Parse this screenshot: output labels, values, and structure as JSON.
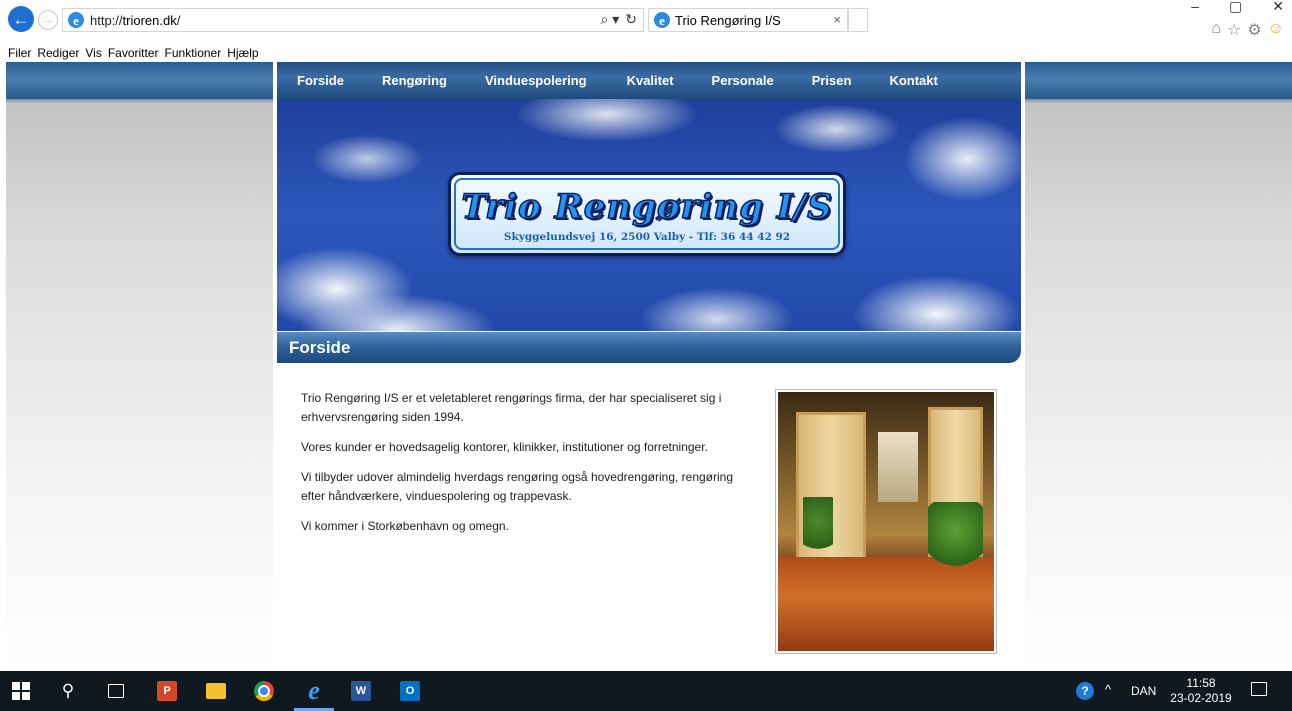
{
  "browser": {
    "url_prefix": "http://",
    "url_domain": "trioren.dk",
    "url_suffix": "/",
    "tab_title": "Trio Rengøring I/S",
    "tab_close": "×",
    "search_glyph": "⌕ ▾",
    "refresh_glyph": "↻",
    "back_glyph": "←",
    "forward_glyph": "→",
    "window_controls": [
      "–",
      "▢",
      "✕"
    ],
    "toolbar_icons": [
      "⌂",
      "☆",
      "⚙",
      "☺"
    ],
    "menu": [
      "Filer",
      "Rediger",
      "Vis",
      "Favoritter",
      "Funktioner",
      "Hjælp"
    ]
  },
  "site": {
    "nav": [
      "Forside",
      "Rengøring",
      "Vinduespolering",
      "Kvalitet",
      "Personale",
      "Prisen",
      "Kontakt"
    ],
    "logo_title": "Trio Rengøring I/S",
    "logo_subtitle": "Skyggelundsvej 16, 2500 Valby - Tlf: 36 44 42 92",
    "page_title": "Forside",
    "paragraphs": [
      "Trio Rengøring I/S er et veletableret rengørings firma, der har specialiseret sig i erhvervsrengøring siden 1994.",
      "Vores kunder er hovedsagelig kontorer, klinikker, institutioner og forretninger.",
      "Vi tilbyder udover almindelig hverdags rengøring også hovedrengøring, rengøring efter håndværkere, vinduespolering og trappevask.",
      "Vi kommer i Storkøbenhavn og omegn."
    ]
  },
  "taskbar": {
    "ppt_label": "P",
    "word_label": "W",
    "outlook_label": "O",
    "search_glyph": "⚲",
    "ie_glyph": "e",
    "help_glyph": "?",
    "tray_arrow": "^",
    "language": "DAN",
    "time": "11:58",
    "date": "23-02-2019"
  },
  "colors": {
    "nav_blue": "#2b5a8e",
    "title_bar_blue": "#2e5f97",
    "logo_blue": "#2592f0"
  }
}
